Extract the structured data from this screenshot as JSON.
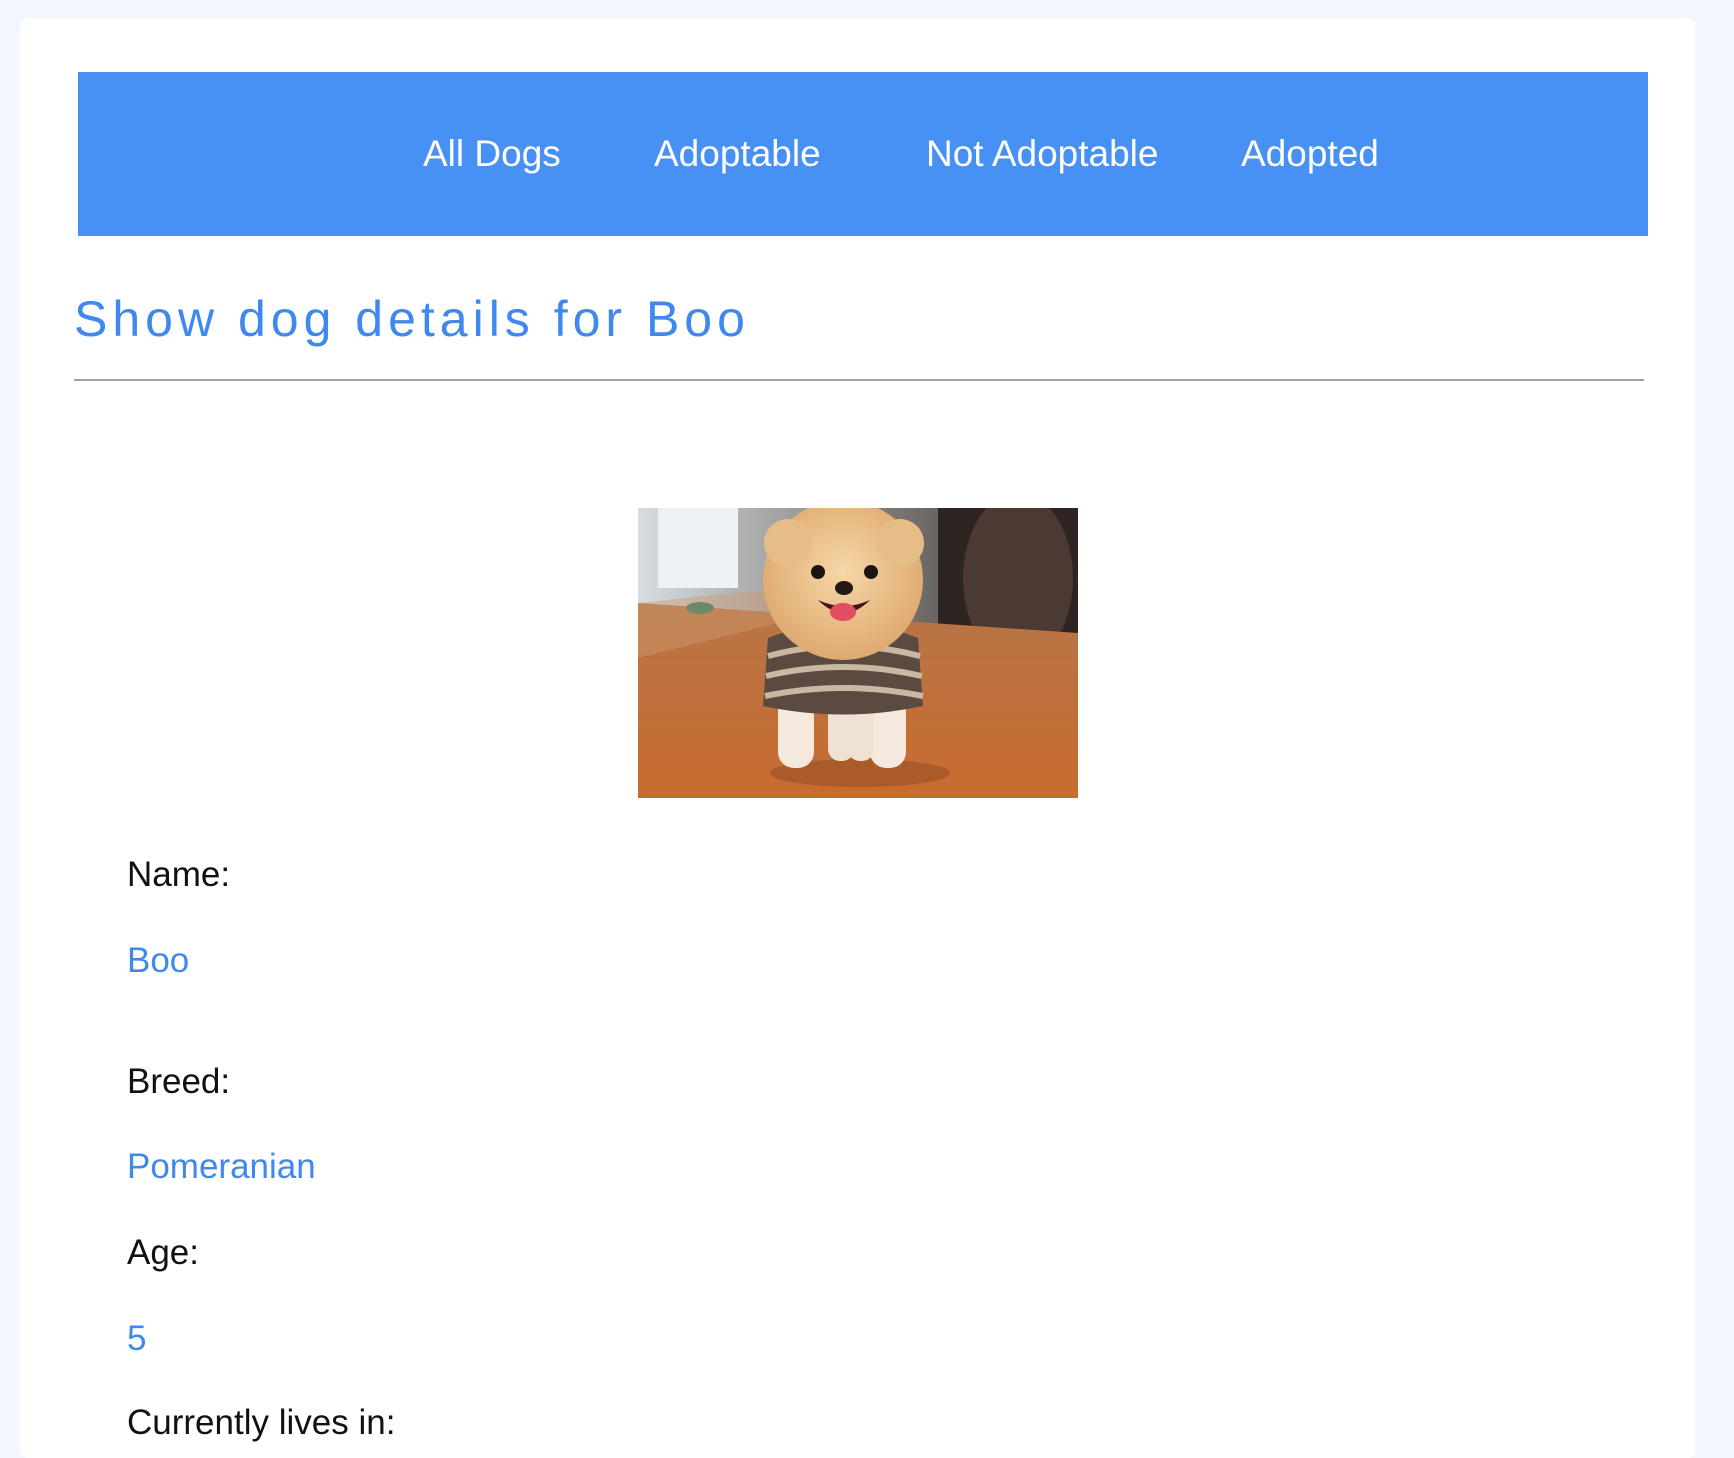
{
  "nav": {
    "items": [
      {
        "label": "All Dogs"
      },
      {
        "label": "Adoptable"
      },
      {
        "label": "Not Adoptable"
      },
      {
        "label": "Adopted"
      }
    ]
  },
  "page": {
    "title": "Show dog details for Boo"
  },
  "photo": {
    "subject": "Pomeranian dog in striped shirt standing on a table"
  },
  "details": {
    "name_label": "Name:",
    "name_value": "Boo",
    "breed_label": "Breed:",
    "breed_value": "Pomeranian",
    "age_label": "Age:",
    "age_value": "5",
    "location_label": "Currently lives in:"
  },
  "colors": {
    "nav_background": "#4790f4",
    "accent_text": "#3f88ee",
    "page_background": "#f1f7fd"
  }
}
